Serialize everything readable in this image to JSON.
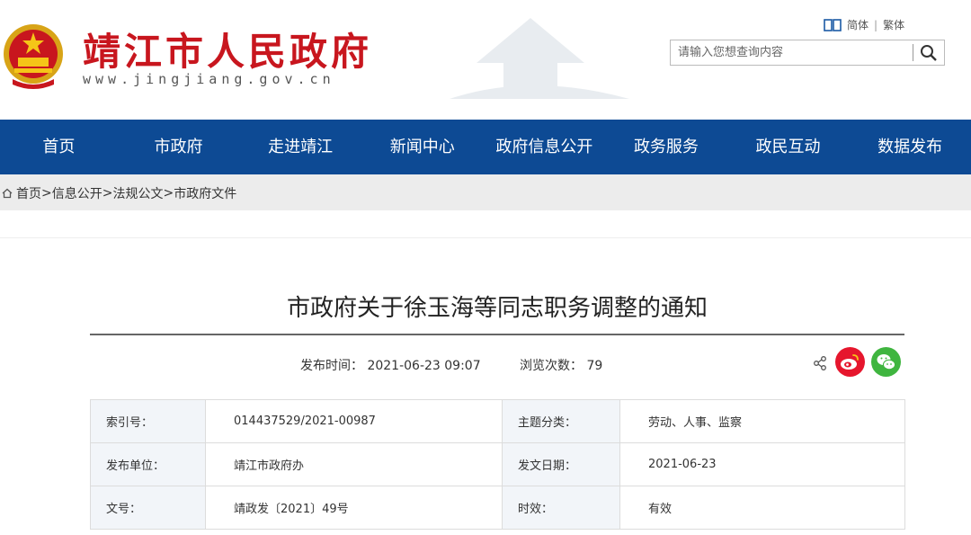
{
  "site": {
    "title": "靖江市人民政府",
    "domain": "www.jingjiang.gov.cn"
  },
  "lang": {
    "simplified": "简体",
    "separator": "|",
    "traditional": "繁体"
  },
  "search": {
    "placeholder": "请输入您想查询内容"
  },
  "nav": [
    {
      "label": "首页"
    },
    {
      "label": "市政府"
    },
    {
      "label": "走进靖江"
    },
    {
      "label": "新闻中心"
    },
    {
      "label": "政府信息公开"
    },
    {
      "label": "政务服务"
    },
    {
      "label": "政民互动"
    },
    {
      "label": "数据发布"
    }
  ],
  "breadcrumb": {
    "items": [
      "首页",
      "信息公开",
      "法规公文",
      "市政府文件"
    ],
    "separator": ">"
  },
  "article": {
    "title": "市政府关于徐玉海等同志职务调整的通知",
    "publish_label": "发布时间：",
    "publish_time": "2021-06-23 09:07",
    "views_label": "浏览次数：",
    "views": "79"
  },
  "info": {
    "rows": [
      {
        "k1": "索引号：",
        "v1": "014437529/2021-00987",
        "k2": "主题分类：",
        "v2": "劳动、人事、监察"
      },
      {
        "k1": "发布单位：",
        "v1": "靖江市政府办",
        "k2": "发文日期：",
        "v2": "2021-06-23"
      },
      {
        "k1": "文号：",
        "v1": "靖政发〔2021〕49号",
        "k2": "时效：",
        "v2": "有效"
      }
    ]
  },
  "colors": {
    "brand_red": "#c8161e",
    "nav_blue": "#0d4a94",
    "weibo_red": "#e6162d",
    "wechat_green": "#3fb53f"
  },
  "icons": [
    "emblem-icon",
    "book-icon",
    "search-icon",
    "home-icon",
    "share-icon",
    "weibo-icon",
    "wechat-icon"
  ]
}
